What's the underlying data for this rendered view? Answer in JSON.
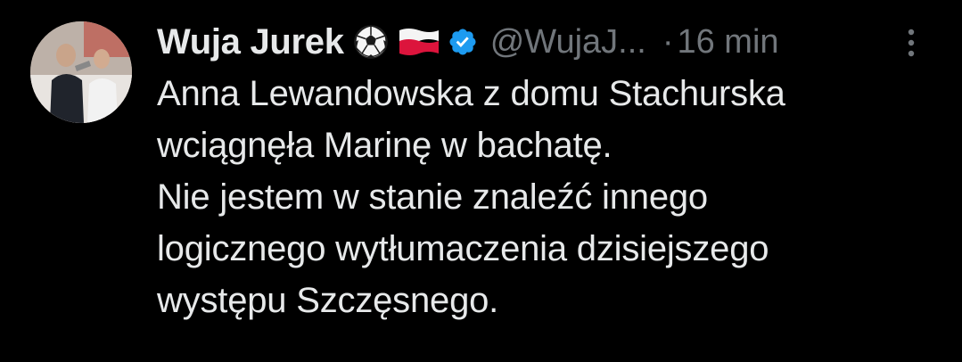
{
  "tweet": {
    "author": {
      "display_name": "Wuja Jurek",
      "handle": "@WujaJ...",
      "emojis": [
        "soccer-ball",
        "poland-flag"
      ],
      "verified": true
    },
    "separator": "·",
    "time": "16 min",
    "text_lines": [
      "Anna Lewandowska z domu Stachurska",
      "wciągnęła Marinę w bachatę.",
      "Nie jestem w stanie znaleźć innego",
      "logicznego wytłumaczenia dzisiejszego",
      "występu Szczęsnego."
    ]
  },
  "colors": {
    "background": "#000000",
    "primary_text": "#e7e9ea",
    "secondary_text": "#71767b",
    "verified_blue": "#1d9bf0"
  },
  "icons": {
    "more": "more-vertical-icon",
    "verified": "verified-badge-icon"
  }
}
